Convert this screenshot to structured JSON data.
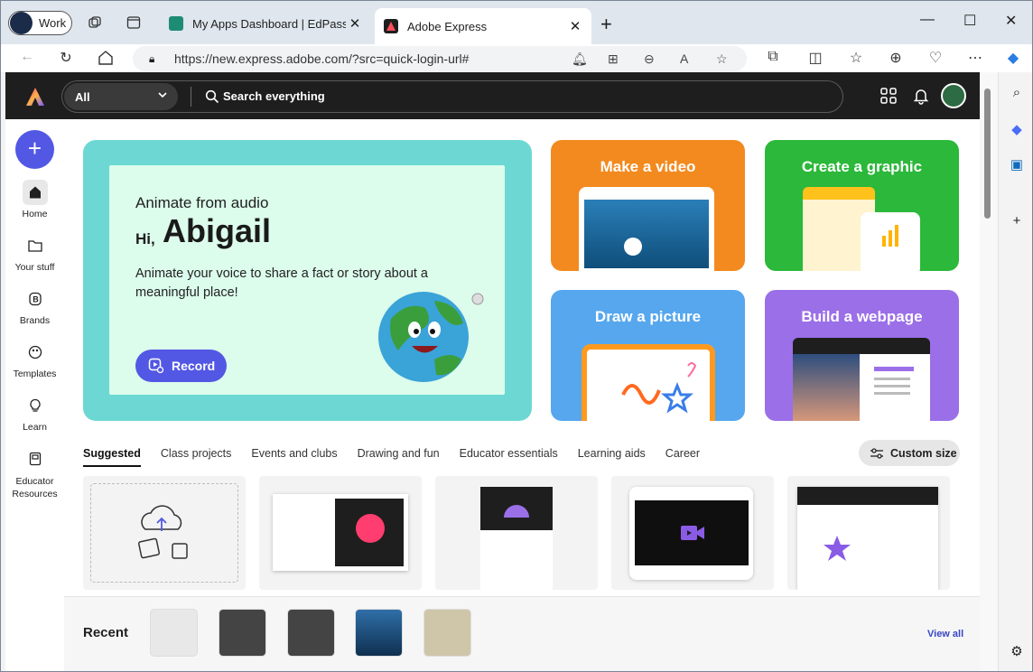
{
  "browser": {
    "profile_label": "Work",
    "tabs": [
      {
        "title": "My Apps Dashboard | EdPass - Ed",
        "close": "✕"
      },
      {
        "title": "Adobe Express",
        "close": "✕"
      }
    ],
    "new_tab": "+",
    "window_controls": [
      "—",
      "☐",
      "✕"
    ],
    "url": "https://new.express.adobe.com/?src=quick-login-url#"
  },
  "topbar": {
    "scope_selected": "All",
    "search_placeholder": "Search everything"
  },
  "rail": {
    "create": "+",
    "items": [
      {
        "label": "Home"
      },
      {
        "label": "Your stuff"
      },
      {
        "label": "Brands"
      },
      {
        "label": "Templates"
      },
      {
        "label": "Learn"
      },
      {
        "label": "Educator Resources"
      }
    ]
  },
  "hero": {
    "subtitle": "Animate from audio",
    "greeting": "Hi,",
    "name": "Abigail",
    "description": "Animate your voice to share a fact or story about a meaningful place!",
    "button": "Record"
  },
  "cards": [
    {
      "title": "Make a video",
      "color": "#f38a1f"
    },
    {
      "title": "Create a graphic",
      "color": "#2cb83a"
    },
    {
      "title": "Draw a picture",
      "color": "#56a7ee"
    },
    {
      "title": "Build a webpage",
      "color": "#9b6fe8"
    }
  ],
  "category_tabs": [
    "Suggested",
    "Class projects",
    "Events and clubs",
    "Drawing and fun",
    "Educator essentials",
    "Learning aids",
    "Career"
  ],
  "custom_size": "Custom size",
  "recent": {
    "label": "Recent",
    "view_all": "View all"
  },
  "colors": {
    "accent": "#5258e4",
    "topbar": "#1e1e1e",
    "hero": "#6dd8d3"
  }
}
